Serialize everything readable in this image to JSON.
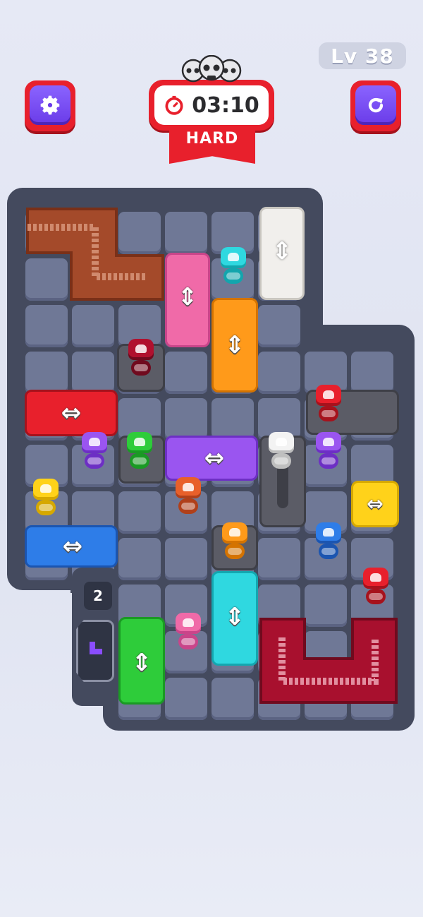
{
  "hud": {
    "level": "Lv 38",
    "timer": "03:10",
    "difficulty": "HARD"
  },
  "side_panel": {
    "count": "2"
  },
  "colors": {
    "red": "#e8202c",
    "purple": "#6a3be8",
    "board": "#444a5e",
    "tile": "#6f7896"
  }
}
